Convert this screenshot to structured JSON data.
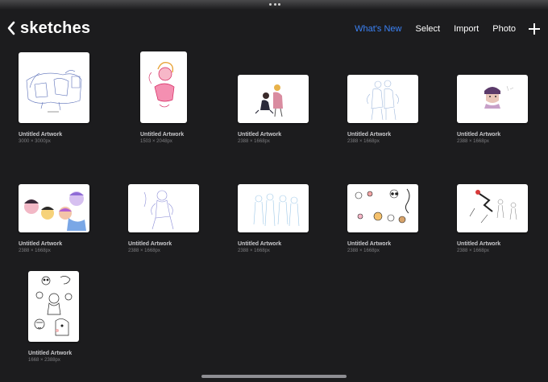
{
  "header": {
    "title": "sketches",
    "whats_new_label": "What's New",
    "select_label": "Select",
    "import_label": "Import",
    "photo_label": "Photo",
    "accent_color": "#3b82f6"
  },
  "artworks": [
    {
      "title": "Untitled Artwork",
      "size": "3000 × 3000px"
    },
    {
      "title": "Untitled Artwork",
      "size": "1503 × 2048px"
    },
    {
      "title": "Untitled Artwork",
      "size": "2388 × 1668px"
    },
    {
      "title": "Untitled Artwork",
      "size": "2388 × 1668px"
    },
    {
      "title": "Untitled Artwork",
      "size": "2388 × 1668px"
    },
    {
      "title": "Untitled Artwork",
      "size": "2388 × 1668px"
    },
    {
      "title": "Untitled Artwork",
      "size": "2388 × 1668px"
    },
    {
      "title": "Untitled Artwork",
      "size": "2388 × 1668px"
    },
    {
      "title": "Untitled Artwork",
      "size": "2388 × 1668px"
    },
    {
      "title": "Untitled Artwork",
      "size": "2388 × 1668px"
    },
    {
      "title": "Untitled Artwork",
      "size": "1668 × 2388px"
    }
  ]
}
